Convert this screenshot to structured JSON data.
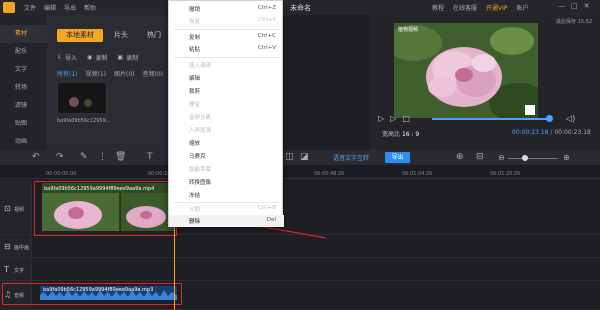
{
  "titlebar": {
    "menu": [
      "文件",
      "编辑",
      "导出",
      "帮助"
    ],
    "doc_title": "未命名",
    "right_links": [
      "教程",
      "在线客服",
      "开通VIP",
      "账户"
    ],
    "window_controls": [
      "—",
      "□",
      "✕"
    ]
  },
  "leftnav": {
    "items": [
      "素材",
      "配乐",
      "文字",
      "转场",
      "滤镜",
      "贴图",
      "动画"
    ]
  },
  "media": {
    "tabs": [
      "本地素材",
      "片头",
      "热门"
    ],
    "actions": [
      "导入",
      "录制",
      "录制"
    ],
    "filters": [
      "所有(1)",
      "视频(1)",
      "图片(0)",
      "音频(0)"
    ],
    "clip_name": "ba9fa09b56c12959..."
  },
  "preview": {
    "time_top": "最后保存 15:52",
    "watermark": "植物视频",
    "ratio_label": "宽高比",
    "ratio_value": "16 : 9",
    "current_time": "00:00:23.18",
    "total_time": "00:00:23.18",
    "progress": 0.97
  },
  "toolbar": {
    "speech_to_text": "语音文字互转",
    "export": "导出"
  },
  "ruler": {
    "ticks": [
      "00:00:00.00",
      "00:00:16.00",
      "00:00:48.00",
      "00:01:04.00",
      "00:01:20.00"
    ]
  },
  "tracks": {
    "video_label": "视频",
    "pip_label": "画中画",
    "text_label": "文字",
    "audio_label": "音频",
    "video_clip_name": "ba9fa09b56c12959a9994f89eee9aa9a.mp4",
    "audio_clip_name": "ba9fa09b56c12959a9994f89eee9aa9a.mp3"
  },
  "context_menu": {
    "items": [
      {
        "label": "撤销",
        "shortcut": "Ctrl+Z",
        "enabled": true
      },
      {
        "label": "恢复",
        "shortcut": "Ctrl+Y",
        "enabled": false
      },
      {
        "label": "复制",
        "shortcut": "Ctrl+C",
        "enabled": true
      },
      {
        "label": "粘贴",
        "shortcut": "Ctrl+V",
        "enabled": true
      },
      {
        "label": "插入调速",
        "shortcut": "",
        "enabled": false
      },
      {
        "label": "编辑",
        "shortcut": "",
        "enabled": true
      },
      {
        "label": "裁剪",
        "shortcut": "",
        "enabled": true
      },
      {
        "label": "静音",
        "shortcut": "",
        "enabled": false
      },
      {
        "label": "音频分离",
        "shortcut": "",
        "enabled": false
      },
      {
        "label": "人声增强",
        "shortcut": "",
        "enabled": false
      },
      {
        "label": "缩放",
        "shortcut": "",
        "enabled": true
      },
      {
        "label": "马赛克",
        "shortcut": "",
        "enabled": true
      },
      {
        "label": "智能字幕",
        "shortcut": "",
        "enabled": false
      },
      {
        "label": "转换图像",
        "shortcut": "",
        "enabled": true
      },
      {
        "label": "冻结",
        "shortcut": "",
        "enabled": true
      },
      {
        "label": "分割",
        "shortcut": "Ctrl+B",
        "enabled": false
      },
      {
        "label": "删除",
        "shortcut": "Del",
        "enabled": true
      }
    ]
  },
  "colors": {
    "accent": "#f5a623",
    "blue": "#2f8cf0",
    "highlight_red": "#e02424"
  }
}
